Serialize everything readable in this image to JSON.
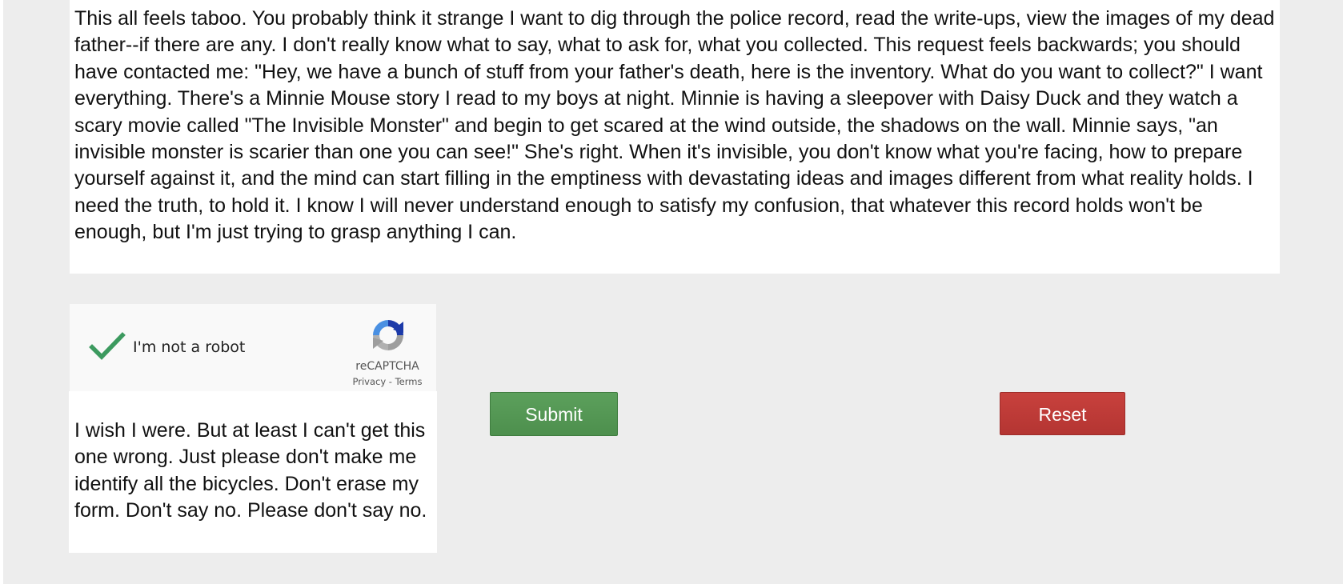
{
  "essay": {
    "text": "This all feels taboo. You probably think it strange I want to dig through the police record, read the write-ups, view the images of my dead father--if there are any. I don't really know what to say, what to ask for, what you collected. This request feels backwards; you should have contacted me: \"Hey, we have a bunch of stuff from your father's death, here is the inventory. What do you want to collect?\" I want everything. There's a Minnie Mouse story I read to my boys at night. Minnie is having a sleepover with Daisy Duck and they watch a scary movie called \"The Invisible Monster\" and begin to get scared at the wind outside, the shadows on the wall. Minnie says, \"an invisible monster is scarier than one you can see!\" She's right. When it's invisible, you don't know what you're facing, how to prepare yourself against it, and the mind can start filling in the emptiness with devastating ideas and images different from what reality holds. I need the truth, to hold it. I know I will never understand enough to satisfy my confusion, that whatever this record holds won't be enough, but I'm just trying to grasp anything I can."
  },
  "captcha": {
    "label": "I'm not a robot",
    "checked": true,
    "check_icon": "checkmark-icon",
    "logo_icon": "recaptcha-logo-icon",
    "brand": "reCAPTCHA",
    "privacy": "Privacy",
    "separator": " - ",
    "terms": "Terms",
    "check_color": "#3c9a5f"
  },
  "note": {
    "text": "I wish I were. But at least I can't get this one wrong. Just please don't make me identify all the bicycles. Don't erase my form. Don't say no. Please don't say no."
  },
  "buttons": {
    "submit_label": "Submit",
    "reset_label": "Reset",
    "submit_color": "#5a9e5a",
    "reset_color": "#c23c39"
  }
}
